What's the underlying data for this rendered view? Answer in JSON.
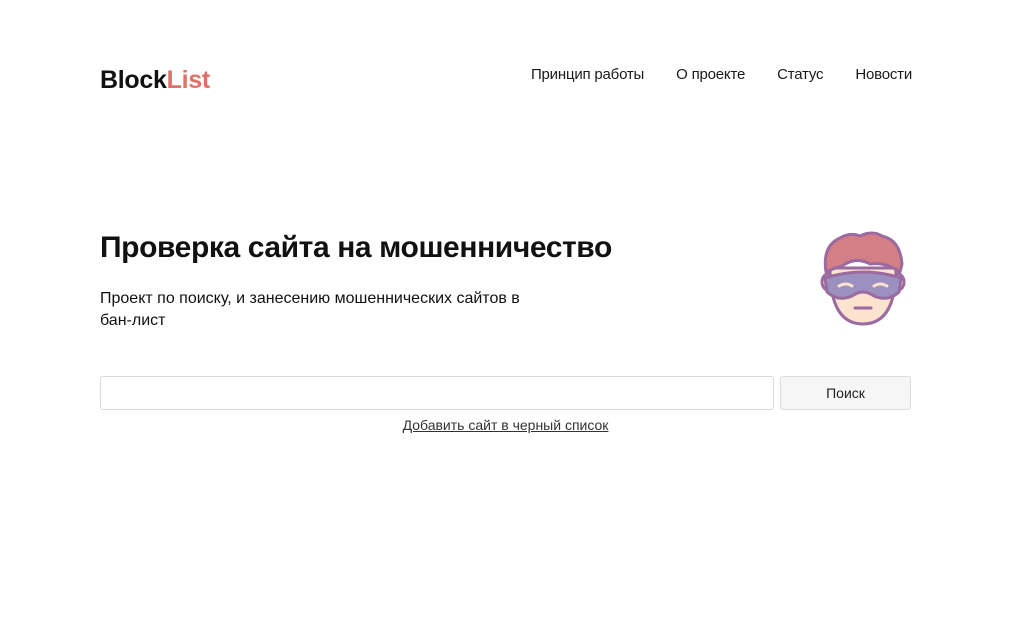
{
  "header": {
    "logo_part1": "Block",
    "logo_part2": "List",
    "nav": [
      {
        "label": "Принцип работы"
      },
      {
        "label": "О проекте"
      },
      {
        "label": "Статус"
      },
      {
        "label": "Новости"
      }
    ]
  },
  "hero": {
    "title": "Проверка сайта на мошенничество",
    "subtitle": "Проект по поиску, и занесению мошеннических сайтов в бан-лист",
    "mascot_icon": "masked-robber-icon"
  },
  "search": {
    "value": "",
    "placeholder": "",
    "button_label": "Поиск",
    "add_link_label": "Добавить сайт в черный список"
  },
  "colors": {
    "accent": "#e07168",
    "text": "#111111",
    "button_bg": "#f6f6f6",
    "border": "#d9d9d9",
    "mask": "#9b90bf",
    "hair": "#d47f86",
    "skin": "#fbe3cf",
    "outline": "#9a6aa0"
  }
}
